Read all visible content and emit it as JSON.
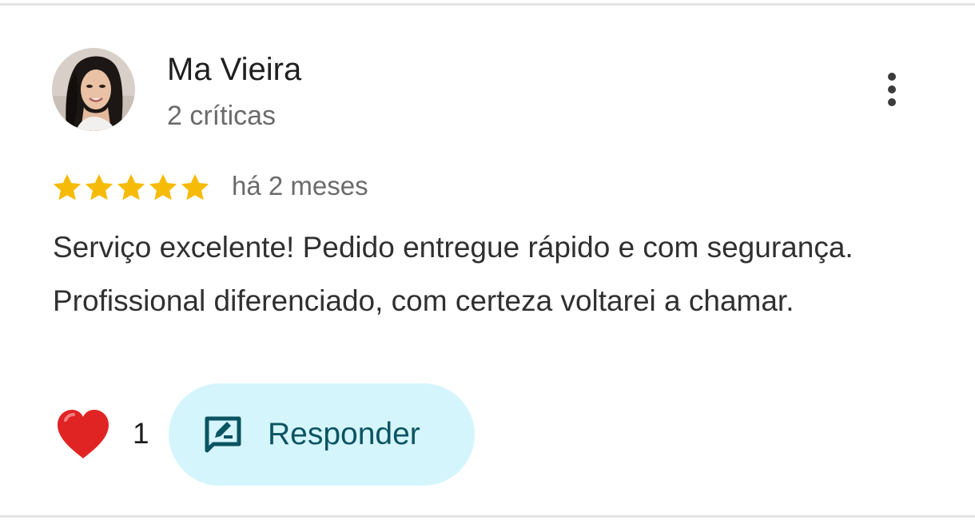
{
  "review": {
    "author": {
      "name": "Ma Vieira",
      "meta": "2 críticas",
      "avatar_icon": "user-avatar-photo"
    },
    "rating": {
      "stars": 5,
      "max": 5,
      "star_color": "#f6bb06"
    },
    "date": "há 2 meses",
    "text": "Serviço excelente! Pedido entregue rápido e com segurança. Profissional diferenciado, com certeza voltarei a chamar.",
    "more_icon": "more-vertical-icon"
  },
  "actions": {
    "like_icon": "heart-icon",
    "like_count": "1",
    "reply_icon": "reply-edit-icon",
    "reply_label": "Responder",
    "reply_bg": "#d5f5fd",
    "reply_fg": "#0b5462",
    "heart_color": "#e02424"
  }
}
